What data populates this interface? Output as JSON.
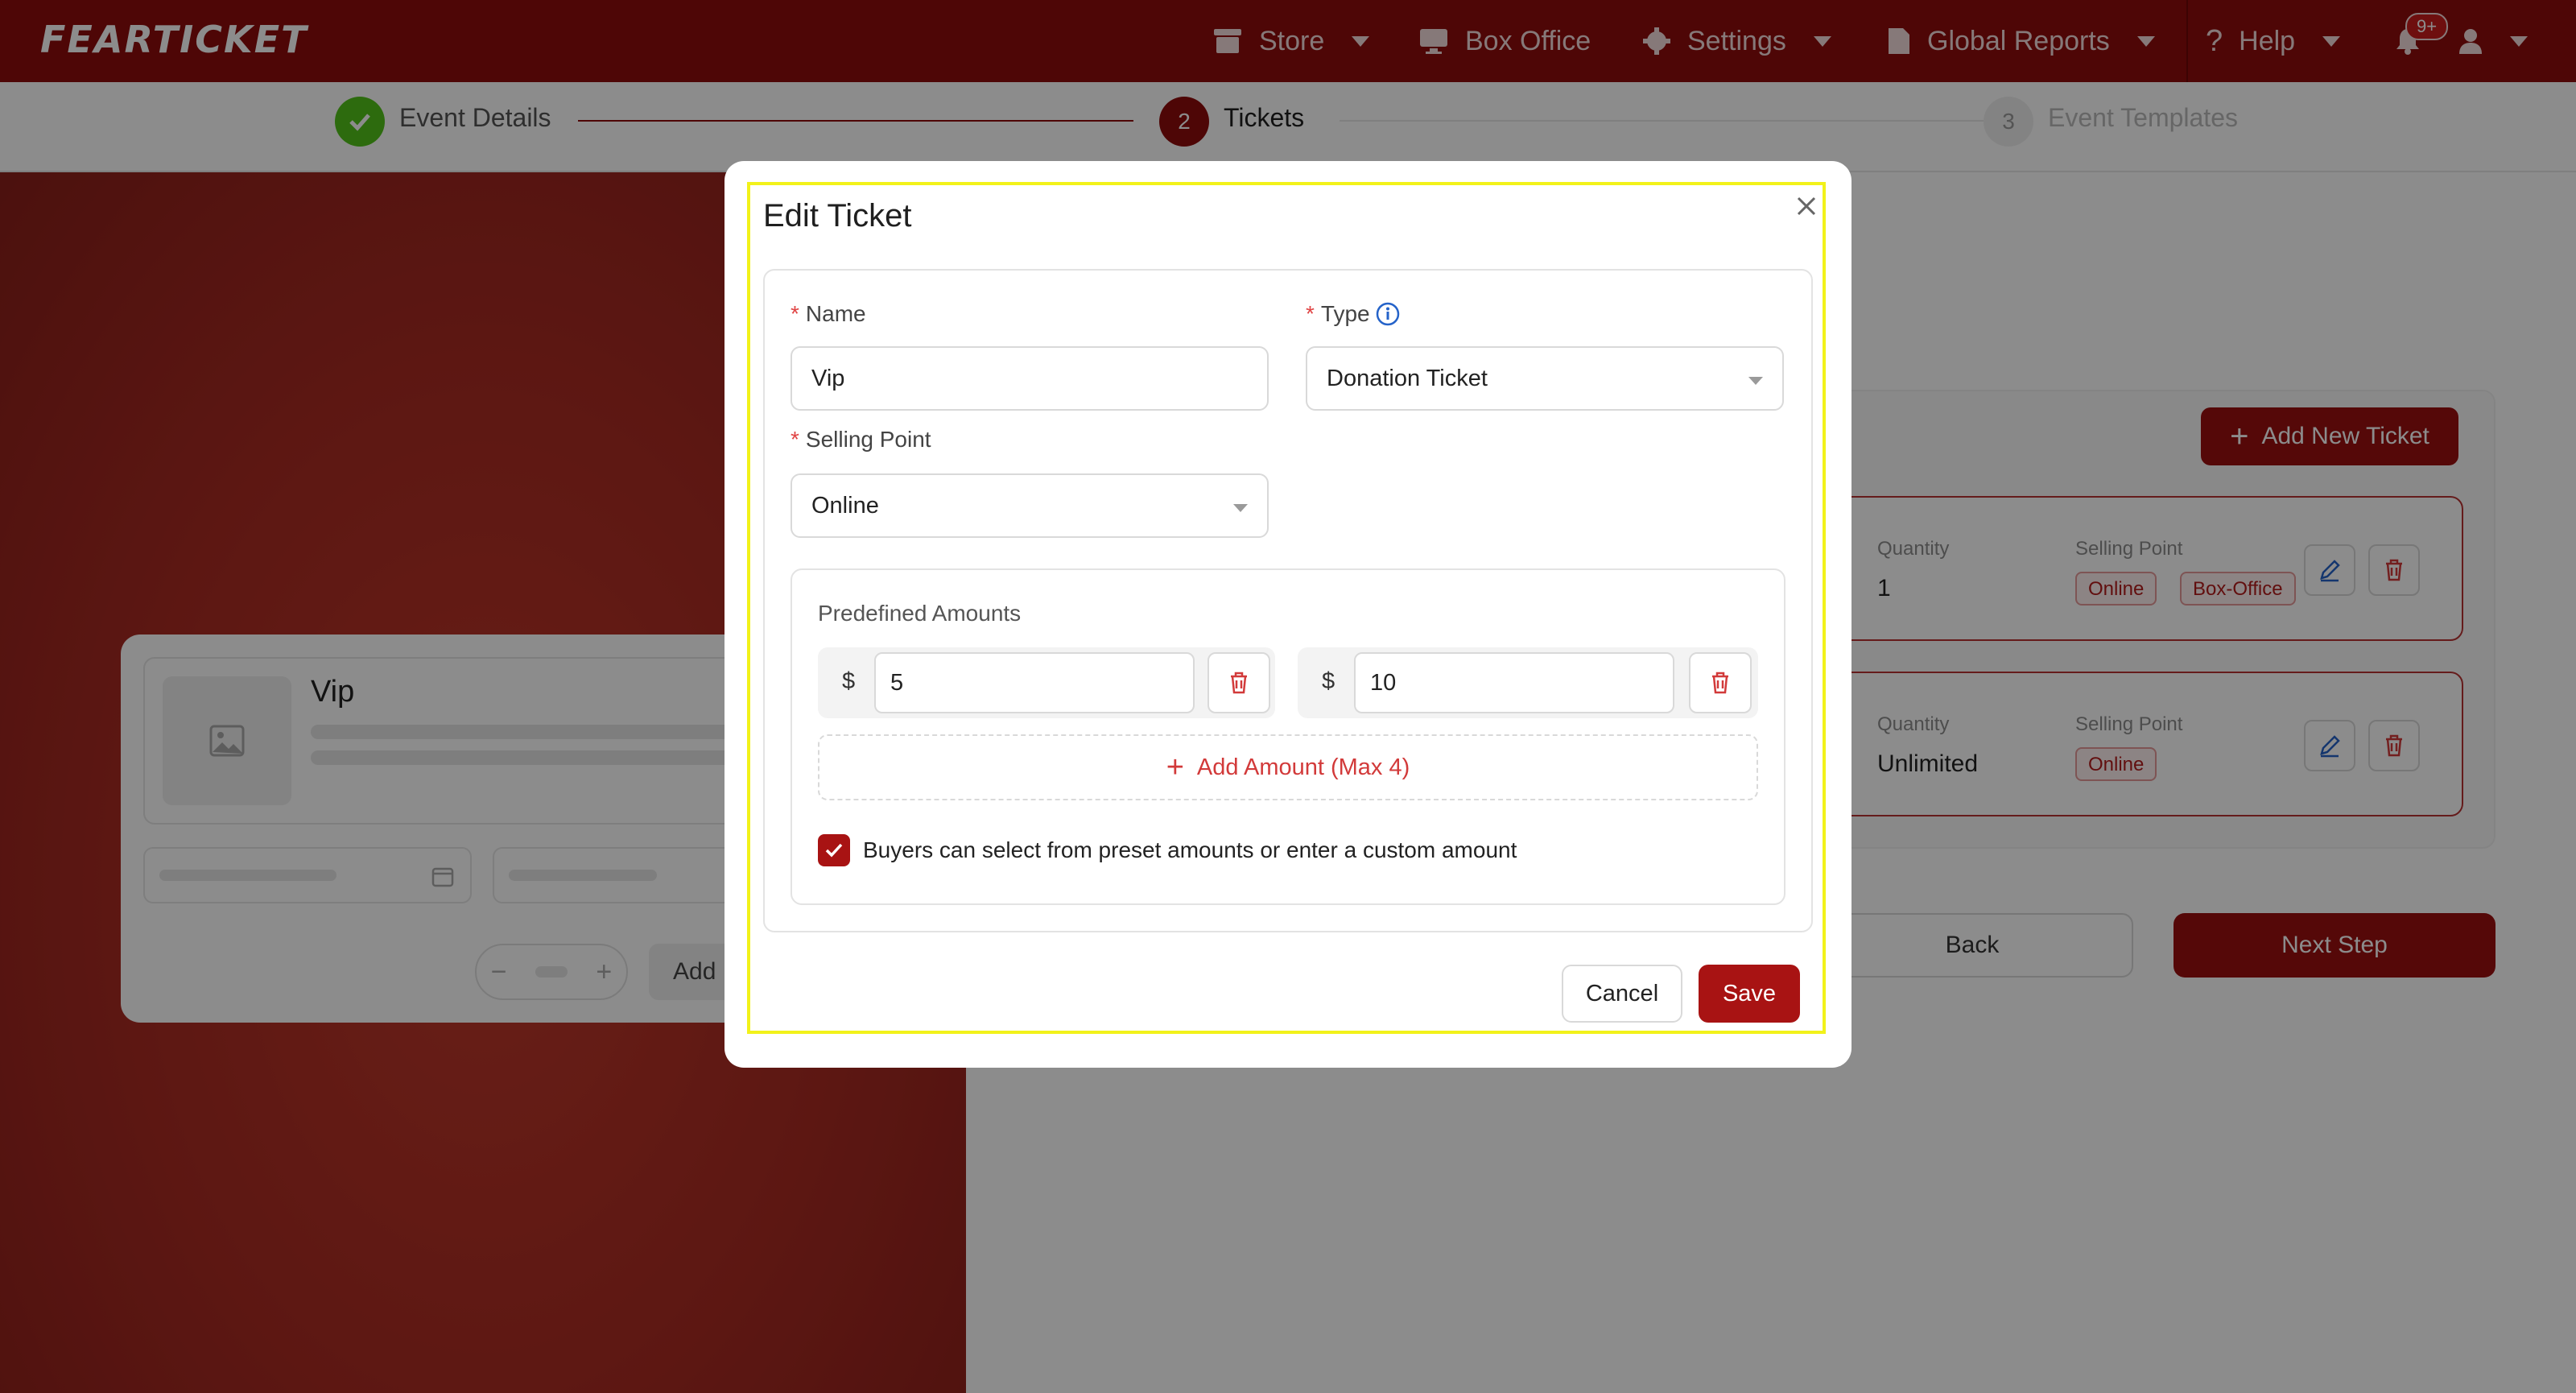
{
  "brand": {
    "logo": "FEARTICKET",
    "accent": "#8e0b0b"
  },
  "nav": {
    "store": "Store",
    "box_office": "Box Office",
    "settings": "Settings",
    "global_reports": "Global Reports",
    "help": "Help",
    "notification_badge": "9+"
  },
  "stepper": {
    "steps": [
      {
        "label": "Event Details",
        "number": "",
        "status": "done"
      },
      {
        "label": "Tickets",
        "number": "2",
        "status": "active"
      },
      {
        "label": "Event Templates",
        "number": "3",
        "status": "pending"
      }
    ]
  },
  "preview": {
    "ticket_title": "Vip",
    "add_label": "Add"
  },
  "tickets_panel": {
    "add_new_ticket": "Add New Ticket",
    "cards": [
      {
        "quantity_label": "Quantity",
        "quantity": "1",
        "selling_point_label": "Selling Point",
        "tags": [
          "Online",
          "Box-Office"
        ]
      },
      {
        "quantity_label": "Quantity",
        "quantity": "Unlimited",
        "selling_point_label": "Selling Point",
        "tags": [
          "Online"
        ]
      }
    ],
    "back": "Back",
    "next_step": "Next Step"
  },
  "modal": {
    "title": "Edit Ticket",
    "name_label": "Name",
    "name_value": "Vip",
    "type_label": "Type",
    "type_value": "Donation Ticket",
    "selling_point_label": "Selling Point",
    "selling_point_value": "Online",
    "predefined_amounts_label": "Predefined Amounts",
    "currency_symbol": "$",
    "amounts": [
      "5",
      "10"
    ],
    "add_amount": "Add Amount (Max 4)",
    "custom_amount_checkbox": "Buyers can select from preset amounts or enter a custom amount",
    "custom_amount_checked": true,
    "cancel": "Cancel",
    "save": "Save"
  }
}
